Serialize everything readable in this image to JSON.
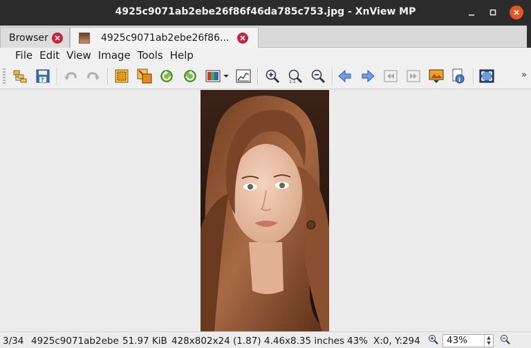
{
  "window": {
    "title": "4925c9071ab2ebe26f86f46da785c753.jpg - XnView MP"
  },
  "tabs": [
    {
      "label": "Browser",
      "active": false
    },
    {
      "label": "4925c9071ab2ebe26f86...",
      "active": true
    }
  ],
  "menu": [
    "File",
    "Edit",
    "View",
    "Image",
    "Tools",
    "Help"
  ],
  "toolbar": {
    "icons": [
      "browser-folder-icon",
      "save-icon",
      "undo-icon",
      "redo-icon",
      "crop-icon",
      "resize-icon",
      "rotate-left-icon",
      "rotate-right-icon",
      "adjust-colors-icon",
      "histogram-icon",
      "zoom-in-icon",
      "zoom-fit-icon",
      "zoom-out-icon",
      "previous-icon",
      "next-icon",
      "first-icon",
      "last-icon",
      "slideshow-icon",
      "properties-icon",
      "fullscreen-icon"
    ],
    "more": "»"
  },
  "status": {
    "position": "3/34",
    "filename": "4925c9071ab2ebe26f86f46da785c753",
    "filename_display": "4925c9071ab2ebe",
    "filesize": "51.97 KiB",
    "dimensions": "428x802x24 (1.87)",
    "print_size": "4.46x8.35 inches",
    "zoom_percent": "43%",
    "coords": "X:0, Y:294",
    "zoom_value": "43%"
  },
  "colors": {
    "titlebar": "#2c2c2c",
    "close_accent": "#e95420",
    "tab_close": "#c9243a"
  }
}
